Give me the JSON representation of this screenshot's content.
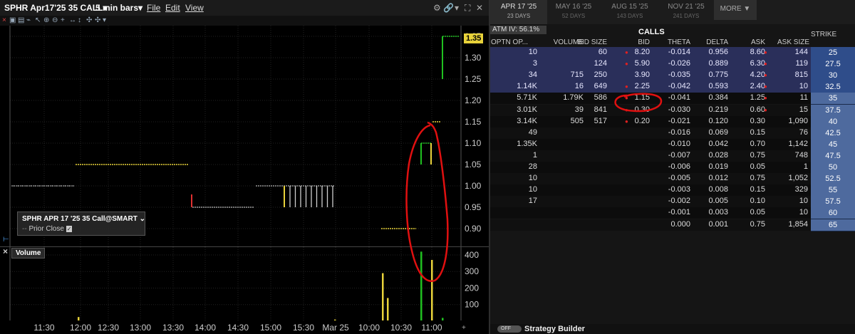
{
  "chart_window": {
    "symbol_title": "SPHR Apr17'25 35 CALL",
    "interval": "5 min bars",
    "menus": [
      "File",
      "Edit",
      "View"
    ],
    "legend": {
      "title": "SPHR APR 17 '25 35 Call@SMART",
      "prior_close": "Prior Close"
    },
    "volume_tag": "Volume",
    "last_price_tag": "1.35"
  },
  "chart_data": [
    {
      "type": "bar",
      "title": "SPHR APR 17 '25 35 Call@SMART",
      "xlabel": "",
      "ylabel": "",
      "x_ticks": [
        "11:30",
        "12:00",
        "12:30",
        "13:00",
        "13:30",
        "14:00",
        "14:30",
        "15:00",
        "15:30",
        "Mar 25",
        "10:00",
        "10:30",
        "11:00"
      ],
      "y_ticks": [
        0.9,
        0.95,
        1.0,
        1.05,
        1.1,
        1.15,
        1.2,
        1.25,
        1.3,
        1.35
      ],
      "ylim": [
        0.875,
        1.365
      ],
      "bars": [
        {
          "x": "11:00",
          "open": 1.0,
          "high": 1.0,
          "low": 1.0,
          "close": 1.0,
          "color": "#9a9a9a"
        },
        {
          "x": "12:00",
          "open": 1.05,
          "high": 1.05,
          "low": 1.05,
          "close": 1.05,
          "color": "#e8d23a"
        },
        {
          "x": "14:00",
          "open": 0.98,
          "high": 0.98,
          "low": 0.95,
          "close": 0.95,
          "color": "#e03030"
        },
        {
          "x": "15:00",
          "open": 1.0,
          "high": 1.0,
          "low": 1.0,
          "close": 1.0,
          "color": "#e8d23a"
        },
        {
          "x": "15:30",
          "open": 1.0,
          "high": 1.0,
          "low": 0.95,
          "close": 0.95,
          "color": "#e8d23a"
        },
        {
          "x": "10:30",
          "open": 0.9,
          "high": 0.9,
          "low": 0.9,
          "close": 0.9,
          "color": "#e8d23a"
        },
        {
          "x": "10:55",
          "open": 1.05,
          "high": 1.1,
          "low": 1.05,
          "close": 1.1,
          "color": "#20c020"
        },
        {
          "x": "11:05",
          "open": 1.15,
          "high": 1.15,
          "low": 1.15,
          "close": 1.15,
          "color": "#e8d23a"
        },
        {
          "x": "11:10",
          "open": 1.25,
          "high": 1.35,
          "low": 1.25,
          "close": 1.35,
          "color": "#20c020"
        }
      ],
      "prior_close": 1.0
    },
    {
      "type": "bar",
      "title": "Volume",
      "y_ticks": [
        100,
        200,
        300,
        400
      ],
      "ylim": [
        0,
        430
      ],
      "values": [
        {
          "x": "12:00",
          "value": 25,
          "color": "#e8d23a"
        },
        {
          "x": "15:30",
          "value": 10,
          "color": "#e8d23a"
        },
        {
          "x": "10:20",
          "value": 290,
          "color": "#e8d23a"
        },
        {
          "x": "10:25",
          "value": 140,
          "color": "#e8d23a"
        },
        {
          "x": "10:55",
          "value": 420,
          "color": "#20c020"
        },
        {
          "x": "11:00",
          "value": 370,
          "color": "#e8d23a"
        },
        {
          "x": "11:10",
          "value": 20,
          "color": "#20c020"
        }
      ]
    }
  ],
  "chain": {
    "expirations": [
      {
        "date": "APR 17 '25",
        "days": "23 DAYS",
        "active": true
      },
      {
        "date": "MAY 16 '25",
        "days": "52 DAYS",
        "active": false
      },
      {
        "date": "AUG 15 '25",
        "days": "143 DAYS",
        "active": false
      },
      {
        "date": "NOV 21 '25",
        "days": "241 DAYS",
        "active": false
      }
    ],
    "more_label": "MORE ▼",
    "atm_iv": "ATM IV: 56.1%",
    "section_label": "CALLS",
    "strike_header": "STRIKE",
    "columns": [
      "OPTN OP...",
      "VOLUME",
      "BID SIZE",
      "BID",
      "THETA",
      "DELTA",
      "ASK",
      "ASK SIZE"
    ],
    "rows": [
      {
        "oi": "10",
        "vol": "",
        "bid_size": "60",
        "bid": "8.20",
        "theta": "-0.014",
        "delta": "0.956",
        "ask": "8.60",
        "ask_size": "144",
        "strike": "25",
        "itm": true,
        "bid_dot": true,
        "ask_dot": true
      },
      {
        "oi": "3",
        "vol": "",
        "bid_size": "124",
        "bid": "5.90",
        "theta": "-0.026",
        "delta": "0.889",
        "ask": "6.30",
        "ask_size": "119",
        "strike": "27.5",
        "itm": true,
        "bid_dot": true,
        "ask_dot": true
      },
      {
        "oi": "34",
        "vol": "715",
        "bid_size": "250",
        "bid": "3.90",
        "theta": "-0.035",
        "delta": "0.775",
        "ask": "4.20",
        "ask_size": "815",
        "strike": "30",
        "itm": true,
        "bid_dot": false,
        "ask_dot": true
      },
      {
        "oi": "1.14K",
        "vol": "16",
        "bid_size": "649",
        "bid": "2.25",
        "theta": "-0.042",
        "delta": "0.593",
        "ask": "2.40",
        "ask_size": "10",
        "strike": "32.5",
        "itm": true,
        "bid_dot": true,
        "ask_dot": true
      },
      {
        "oi": "5.71K",
        "vol": "1.79K",
        "bid_size": "586",
        "bid": "1.15",
        "theta": "-0.041",
        "delta": "0.384",
        "ask": "1.25",
        "ask_size": "11",
        "strike": "35",
        "itm": false,
        "bid_dot": true,
        "ask_dot": true
      },
      {
        "oi": "3.01K",
        "vol": "39",
        "bid_size": "841",
        "bid": "0.30",
        "theta": "-0.030",
        "delta": "0.219",
        "ask": "0.60",
        "ask_size": "15",
        "strike": "37.5",
        "itm": false,
        "bid_dot": true,
        "ask_dot": true
      },
      {
        "oi": "3.14K",
        "vol": "505",
        "bid_size": "517",
        "bid": "0.20",
        "theta": "-0.021",
        "delta": "0.120",
        "ask": "0.30",
        "ask_size": "1,090",
        "strike": "40",
        "itm": false,
        "bid_dot": true,
        "ask_dot": false
      },
      {
        "oi": "49",
        "vol": "",
        "bid_size": "",
        "bid": "",
        "theta": "-0.016",
        "delta": "0.069",
        "ask": "0.15",
        "ask_size": "76",
        "strike": "42.5",
        "itm": false,
        "bid_dot": false,
        "ask_dot": false
      },
      {
        "oi": "1.35K",
        "vol": "",
        "bid_size": "",
        "bid": "",
        "theta": "-0.010",
        "delta": "0.042",
        "ask": "0.70",
        "ask_size": "1,142",
        "strike": "45",
        "itm": false,
        "bid_dot": false,
        "ask_dot": false
      },
      {
        "oi": "1",
        "vol": "",
        "bid_size": "",
        "bid": "",
        "theta": "-0.007",
        "delta": "0.028",
        "ask": "0.75",
        "ask_size": "748",
        "strike": "47.5",
        "itm": false,
        "bid_dot": false,
        "ask_dot": false
      },
      {
        "oi": "28",
        "vol": "",
        "bid_size": "",
        "bid": "",
        "theta": "-0.006",
        "delta": "0.019",
        "ask": "0.05",
        "ask_size": "1",
        "strike": "50",
        "itm": false,
        "bid_dot": false,
        "ask_dot": false
      },
      {
        "oi": "10",
        "vol": "",
        "bid_size": "",
        "bid": "",
        "theta": "-0.005",
        "delta": "0.012",
        "ask": "0.75",
        "ask_size": "1,052",
        "strike": "52.5",
        "itm": false,
        "bid_dot": false,
        "ask_dot": false
      },
      {
        "oi": "10",
        "vol": "",
        "bid_size": "",
        "bid": "",
        "theta": "-0.003",
        "delta": "0.008",
        "ask": "0.15",
        "ask_size": "329",
        "strike": "55",
        "itm": false,
        "bid_dot": false,
        "ask_dot": false
      },
      {
        "oi": "17",
        "vol": "",
        "bid_size": "",
        "bid": "",
        "theta": "-0.002",
        "delta": "0.005",
        "ask": "0.10",
        "ask_size": "10",
        "strike": "57.5",
        "itm": false,
        "bid_dot": false,
        "ask_dot": false
      },
      {
        "oi": "",
        "vol": "",
        "bid_size": "",
        "bid": "",
        "theta": "-0.001",
        "delta": "0.003",
        "ask": "0.05",
        "ask_size": "10",
        "strike": "60",
        "itm": false,
        "bid_dot": false,
        "ask_dot": false
      },
      {
        "oi": "",
        "vol": "",
        "bid_size": "",
        "bid": "",
        "theta": "0.000",
        "delta": "0.001",
        "ask": "0.75",
        "ask_size": "1,854",
        "strike": "65",
        "itm": false,
        "bid_dot": false,
        "ask_dot": false
      }
    ],
    "strategy_toggle": "OFF",
    "strategy_label": "Strategy Builder"
  },
  "colors": {
    "itm_row": "#2a2f5a",
    "itm_strike": "#2f4d8a",
    "otm_strike": "#4e6a9e",
    "bid_ask_dot": "#e02020",
    "annotation": "#e01010"
  }
}
